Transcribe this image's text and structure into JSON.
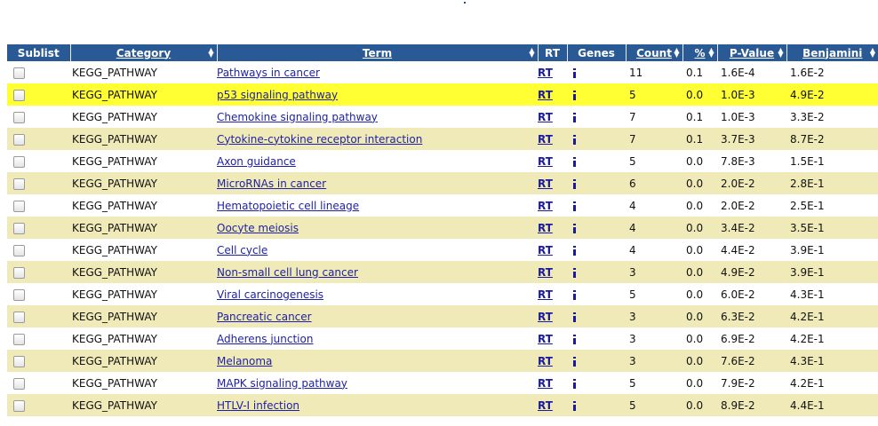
{
  "columns": {
    "sublist": "Sublist",
    "category": "Category",
    "term": "Term",
    "rt": "RT",
    "genes": "Genes",
    "count": "Count",
    "percent": "%",
    "pvalue": "P-Value",
    "benjamini": "Benjamini"
  },
  "rows": [
    {
      "category": "KEGG_PATHWAY",
      "term": "Pathways in cancer",
      "rt": "RT",
      "count": "11",
      "percent": "0.1",
      "pvalue": "1.6E-4",
      "benjamini": "1.6E-2"
    },
    {
      "category": "KEGG_PATHWAY",
      "term": "p53 signaling pathway",
      "rt": "RT",
      "count": "5",
      "percent": "0.0",
      "pvalue": "1.0E-3",
      "benjamini": "4.9E-2"
    },
    {
      "category": "KEGG_PATHWAY",
      "term": "Chemokine signaling pathway",
      "rt": "RT",
      "count": "7",
      "percent": "0.1",
      "pvalue": "1.0E-3",
      "benjamini": "3.3E-2"
    },
    {
      "category": "KEGG_PATHWAY",
      "term": "Cytokine-cytokine receptor interaction",
      "rt": "RT",
      "count": "7",
      "percent": "0.1",
      "pvalue": "3.7E-3",
      "benjamini": "8.7E-2"
    },
    {
      "category": "KEGG_PATHWAY",
      "term": "Axon guidance",
      "rt": "RT",
      "count": "5",
      "percent": "0.0",
      "pvalue": "7.8E-3",
      "benjamini": "1.5E-1"
    },
    {
      "category": "KEGG_PATHWAY",
      "term": "MicroRNAs in cancer",
      "rt": "RT",
      "count": "6",
      "percent": "0.0",
      "pvalue": "2.0E-2",
      "benjamini": "2.8E-1"
    },
    {
      "category": "KEGG_PATHWAY",
      "term": "Hematopoietic cell lineage",
      "rt": "RT",
      "count": "4",
      "percent": "0.0",
      "pvalue": "2.0E-2",
      "benjamini": "2.5E-1"
    },
    {
      "category": "KEGG_PATHWAY",
      "term": "Oocyte meiosis",
      "rt": "RT",
      "count": "4",
      "percent": "0.0",
      "pvalue": "3.4E-2",
      "benjamini": "3.5E-1"
    },
    {
      "category": "KEGG_PATHWAY",
      "term": "Cell cycle",
      "rt": "RT",
      "count": "4",
      "percent": "0.0",
      "pvalue": "4.4E-2",
      "benjamini": "3.9E-1"
    },
    {
      "category": "KEGG_PATHWAY",
      "term": "Non-small cell lung cancer",
      "rt": "RT",
      "count": "3",
      "percent": "0.0",
      "pvalue": "4.9E-2",
      "benjamini": "3.9E-1"
    },
    {
      "category": "KEGG_PATHWAY",
      "term": "Viral carcinogenesis",
      "rt": "RT",
      "count": "5",
      "percent": "0.0",
      "pvalue": "6.0E-2",
      "benjamini": "4.3E-1"
    },
    {
      "category": "KEGG_PATHWAY",
      "term": "Pancreatic cancer",
      "rt": "RT",
      "count": "3",
      "percent": "0.0",
      "pvalue": "6.3E-2",
      "benjamini": "4.2E-1"
    },
    {
      "category": "KEGG_PATHWAY",
      "term": "Adherens junction",
      "rt": "RT",
      "count": "3",
      "percent": "0.0",
      "pvalue": "6.9E-2",
      "benjamini": "4.2E-1"
    },
    {
      "category": "KEGG_PATHWAY",
      "term": "Melanoma",
      "rt": "RT",
      "count": "3",
      "percent": "0.0",
      "pvalue": "7.6E-2",
      "benjamini": "4.3E-1"
    },
    {
      "category": "KEGG_PATHWAY",
      "term": "MAPK signaling pathway",
      "rt": "RT",
      "count": "5",
      "percent": "0.0",
      "pvalue": "7.9E-2",
      "benjamini": "4.2E-1"
    },
    {
      "category": "KEGG_PATHWAY",
      "term": "HTLV-I infection",
      "rt": "RT",
      "count": "5",
      "percent": "0.0",
      "pvalue": "8.9E-2",
      "benjamini": "4.4E-1"
    }
  ],
  "highlight_row": 1,
  "colors": {
    "header_bg": "#2a5a96",
    "alt_row_bg": "#efeab8",
    "highlight_row_bg": "#ffff33",
    "link": "#1d1fa5"
  },
  "icons": {
    "sort": "sort-arrows-icon",
    "genes": "gene-list-icon",
    "checkbox": "checkbox"
  }
}
